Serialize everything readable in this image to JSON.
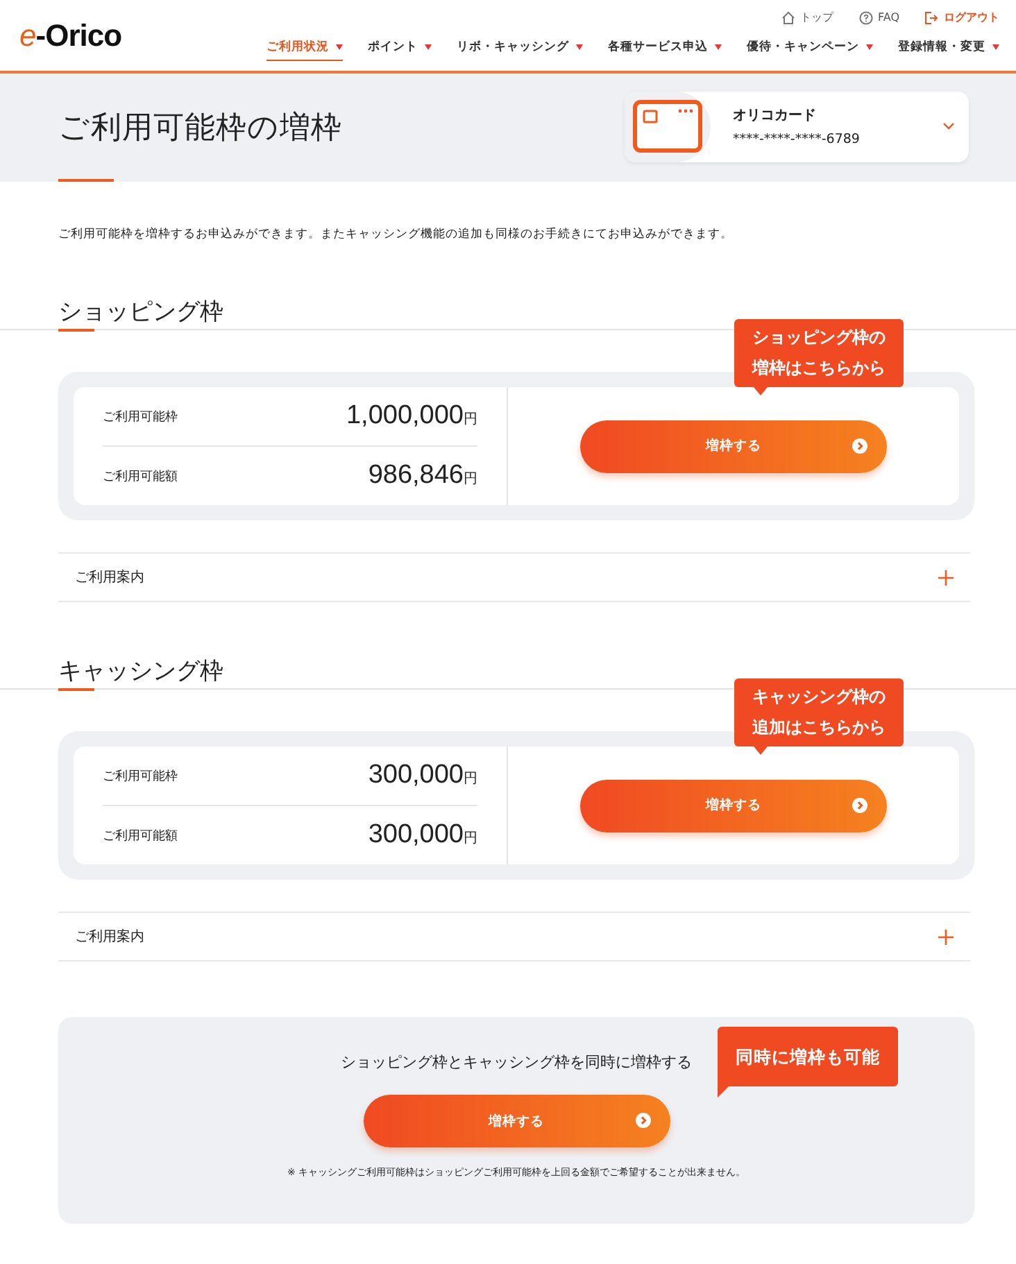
{
  "header": {
    "logo": "e-Orico",
    "top_links": [
      {
        "kind": "home",
        "label": "トップ"
      },
      {
        "kind": "faq",
        "label": "FAQ"
      },
      {
        "kind": "logout",
        "label": "ログアウト"
      }
    ],
    "nav": [
      {
        "label": "ご利用状況",
        "selected": true
      },
      {
        "label": "ポイント",
        "selected": false
      },
      {
        "label": "リボ・キャッシング",
        "selected": false
      },
      {
        "label": "各種サービス申込",
        "selected": false
      },
      {
        "label": "優待・キャンペーン",
        "selected": false
      },
      {
        "label": "登録情報・変更",
        "selected": false
      }
    ]
  },
  "page_title": "ご利用可能枠の増枠",
  "card": {
    "name": "オリコカード",
    "number": "****-****-****-6789"
  },
  "description": "ご利用可能枠を増枠するお申込みができます。またキャッシング機能の追加も同様のお手続きにてお申込みができます。",
  "sections": [
    {
      "title": "ショッピング枠",
      "rows": [
        {
          "label": "ご利用可能枠",
          "amount": "1,000,000",
          "unit": "円"
        },
        {
          "label": "ご利用可能額",
          "amount": "986,846",
          "unit": "円"
        }
      ],
      "button": "増枠する",
      "callout": [
        "ショッピング枠の",
        "増枠はこちらから"
      ],
      "guide": "ご利用案内"
    },
    {
      "title": "キャッシング枠",
      "rows": [
        {
          "label": "ご利用可能枠",
          "amount": "300,000",
          "unit": "円"
        },
        {
          "label": "ご利用可能額",
          "amount": "300,000",
          "unit": "円"
        }
      ],
      "button": "増枠する",
      "callout": [
        "キャッシング枠の",
        "追加はこちらから"
      ],
      "guide": "ご利用案内"
    }
  ],
  "combined": {
    "text": "ショッピング枠とキャッシング枠を同時に増枠する",
    "button": "増枠する",
    "callout": "同時に増枠も可能",
    "note": "※ キャッシングご利用可能枠はショッピングご利用可能枠を上回る金額でご希望することが出来ません。"
  }
}
